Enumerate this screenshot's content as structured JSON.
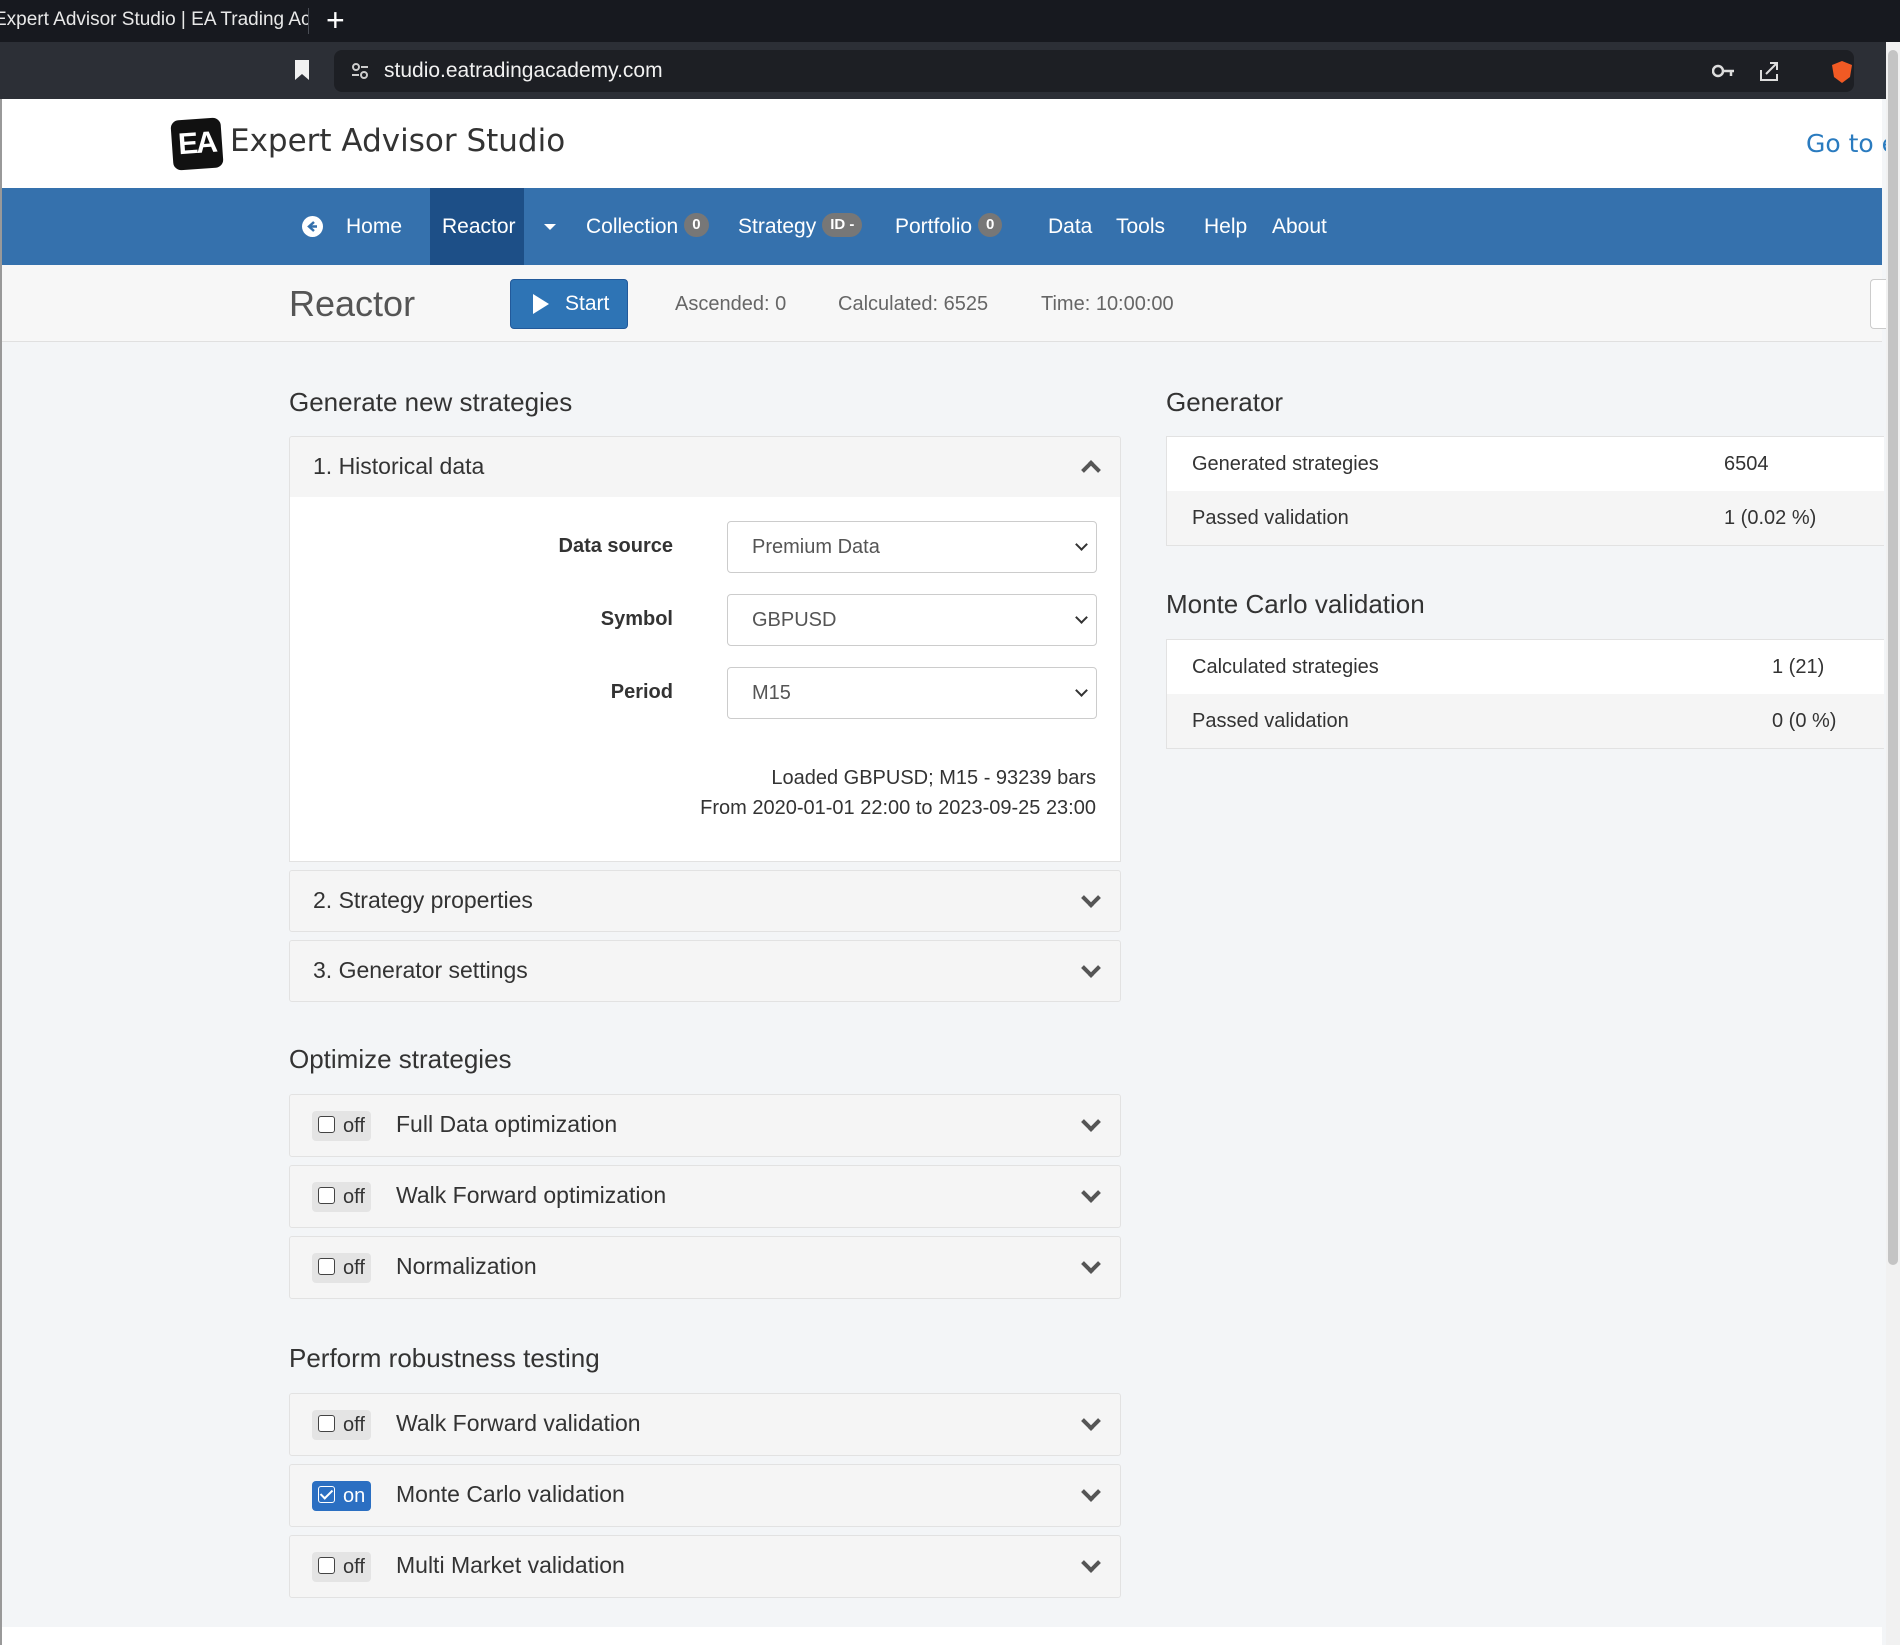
{
  "browser": {
    "tab_title": "Expert Advisor Studio | EA Trading Academy",
    "url": "studio.eatradingacademy.com"
  },
  "header": {
    "logo_text": "EA",
    "brand": "Expert Advisor Studio",
    "goto_link": "Go to e"
  },
  "nav": {
    "home": "Home",
    "reactor": "Reactor",
    "collection": "Collection",
    "collection_count": "0",
    "strategy": "Strategy",
    "strategy_id": "ID -",
    "portfolio": "Portfolio",
    "portfolio_count": "0",
    "data": "Data",
    "tools": "Tools",
    "help": "Help",
    "about": "About"
  },
  "toolbar": {
    "title": "Reactor",
    "start_label": "Start",
    "ascended": "Ascended: 0",
    "calculated": "Calculated: 6525",
    "time": "Time: 10:00:00"
  },
  "generate": {
    "section_title": "Generate new strategies",
    "historical_title": "1. Historical data",
    "data_source_label": "Data source",
    "data_source_value": "Premium Data",
    "symbol_label": "Symbol",
    "symbol_value": "GBPUSD",
    "period_label": "Period",
    "period_value": "M15",
    "loaded_info": "Loaded GBPUSD; M15 - 93239 bars",
    "range_info": "From 2020-01-01 22:00 to 2023-09-25 23:00",
    "strategy_props_title": "2. Strategy properties",
    "generator_settings_title": "3. Generator settings"
  },
  "optimize": {
    "section_title": "Optimize strategies",
    "items": [
      {
        "state": "off",
        "label": "Full Data optimization"
      },
      {
        "state": "off",
        "label": "Walk Forward optimization"
      },
      {
        "state": "off",
        "label": "Normalization"
      }
    ]
  },
  "robustness": {
    "section_title": "Perform robustness testing",
    "items": [
      {
        "state": "off",
        "label": "Walk Forward validation"
      },
      {
        "state": "on",
        "label": "Monte Carlo validation"
      },
      {
        "state": "off",
        "label": "Multi Market validation"
      }
    ]
  },
  "generator_stats": {
    "title": "Generator",
    "generated_label": "Generated strategies",
    "generated_value": "6504",
    "passed_label": "Passed validation",
    "passed_value": "1 (0.02 %)"
  },
  "montecarlo_stats": {
    "title": "Monte Carlo validation",
    "calculated_label": "Calculated strategies",
    "calculated_value": "1 (21)",
    "passed_label": "Passed validation",
    "passed_value": "0 (0 %)"
  },
  "colors": {
    "nav_bg": "#3571ad",
    "nav_active": "#1d4f87",
    "accent": "#2e74b5"
  }
}
